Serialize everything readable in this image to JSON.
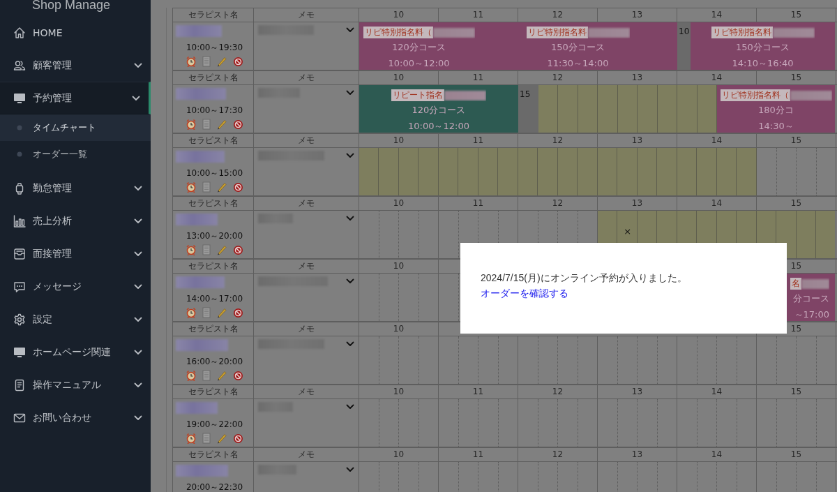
{
  "sidebar": {
    "logo": "Shop Manage",
    "items": [
      {
        "label": "HOME",
        "expandable": false,
        "selected": false
      },
      {
        "label": "顧客管理",
        "expandable": true,
        "selected": false
      },
      {
        "label": "予約管理",
        "expandable": true,
        "selected": true,
        "expanded": true,
        "children": [
          {
            "label": "タイムチャート",
            "selected": true
          },
          {
            "label": "オーダー一覧",
            "selected": false
          }
        ]
      },
      {
        "label": "勤怠管理",
        "expandable": true,
        "selected": false
      },
      {
        "label": "売上分析",
        "expandable": true,
        "selected": false
      },
      {
        "label": "面接管理",
        "expandable": true,
        "selected": false
      },
      {
        "label": "メッセージ",
        "expandable": true,
        "selected": false
      },
      {
        "label": "設定",
        "expandable": true,
        "selected": false
      },
      {
        "label": "ホームページ関連",
        "expandable": true,
        "selected": false
      },
      {
        "label": "操作マニュアル",
        "expandable": true,
        "selected": false
      },
      {
        "label": "お問い合わせ",
        "expandable": true,
        "selected": false
      }
    ]
  },
  "therapists": [
    {
      "columns": [
        "セラピスト名",
        "メモ",
        "10",
        "11",
        "12",
        "13",
        "14",
        "15"
      ],
      "shift": "10:00～19:30",
      "actions": true,
      "segments": [
        {
          "kind": "booking",
          "color": "#7f4466",
          "tag": "リピ特別指名料（",
          "course": "120分コース",
          "time": "10:00～12:00"
        },
        {
          "kind": "booking",
          "color": "#7f4466",
          "tag": "リピ特別指名料",
          "course": "150分コース",
          "time": "11:30～14:00"
        },
        {
          "kind": "break",
          "text": "10"
        },
        {
          "kind": "booking",
          "color": "#7f4466",
          "tag": "リピ特別指名料",
          "course": "150分コース",
          "time": "14:10～16:40"
        }
      ]
    },
    {
      "columns": [
        "セラピスト名",
        "メモ",
        "10",
        "11",
        "12",
        "13",
        "14",
        "15"
      ],
      "shift": "10:00～17:30",
      "actions": true,
      "segments": [
        {
          "kind": "booking",
          "color": "#2d5a52",
          "tag": "リピート指名",
          "course": "120分コース",
          "time": "10:00～12:00"
        },
        {
          "kind": "break",
          "text": "15"
        },
        {
          "kind": "booking",
          "color": "#7f4466",
          "tag": "リピ特別指名料（",
          "course": "180分コ",
          "time": "14:30～"
        }
      ]
    },
    {
      "columns": [
        "セラピスト名",
        "メモ",
        "10",
        "11",
        "12",
        "13",
        "14",
        "15"
      ],
      "shift": "10:00～15:00",
      "actions": true
    },
    {
      "columns": [
        "セラピスト名",
        "メモ",
        "10",
        "11",
        "12",
        "13",
        "14",
        "15"
      ],
      "shift": "13:00～20:00",
      "actions": true,
      "segments": [
        {
          "kind": "mark",
          "text": "×"
        }
      ]
    },
    {
      "columns": [
        "セラピスト名",
        "メモ",
        "10",
        "15"
      ],
      "shift": "14:00～17:00",
      "actions": true,
      "segments": [
        {
          "kind": "booking",
          "color": "#7f4466",
          "tag": "名",
          "course": "分コース",
          "time": "～17:00"
        }
      ]
    },
    {
      "columns": [
        "セラピスト名",
        "メモ",
        "10",
        "15"
      ],
      "shift": "16:00～20:00",
      "actions": true
    },
    {
      "columns": [
        "セラピスト名",
        "メモ",
        "10",
        "11",
        "12",
        "13",
        "14",
        "15"
      ],
      "shift": "19:00～22:00",
      "actions": true
    },
    {
      "columns": [
        "セラピスト名",
        "メモ",
        "10",
        "11",
        "12",
        "13",
        "14",
        "15"
      ],
      "shift": "20:00～22:30",
      "actions": false
    }
  ],
  "dialog": {
    "message": "2024/7/15(月)にオンライン予約が入りました。",
    "link": "オーダーを確認する"
  }
}
